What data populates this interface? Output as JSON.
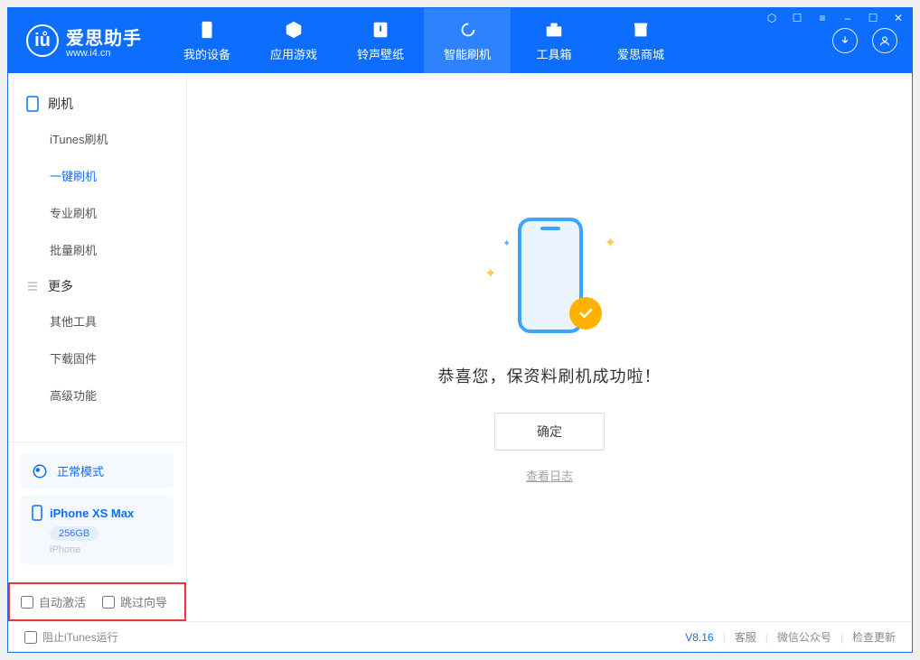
{
  "brand": {
    "name_cn": "爱思助手",
    "name_en": "www.i4.cn"
  },
  "tabs": [
    {
      "label": "我的设备"
    },
    {
      "label": "应用游戏"
    },
    {
      "label": "铃声壁纸"
    },
    {
      "label": "智能刷机"
    },
    {
      "label": "工具箱"
    },
    {
      "label": "爱思商城"
    }
  ],
  "sidebar": {
    "section_flash": "刷机",
    "items_flash": [
      {
        "label": "iTunes刷机"
      },
      {
        "label": "一键刷机"
      },
      {
        "label": "专业刷机"
      },
      {
        "label": "批量刷机"
      }
    ],
    "section_more": "更多",
    "items_more": [
      {
        "label": "其他工具"
      },
      {
        "label": "下载固件"
      },
      {
        "label": "高级功能"
      }
    ],
    "mode": "正常模式",
    "device_name": "iPhone XS Max",
    "device_capacity": "256GB",
    "device_type": "iPhone",
    "opt_auto_activate": "自动激活",
    "opt_skip_guide": "跳过向导"
  },
  "result": {
    "message": "恭喜您，保资料刷机成功啦！",
    "ok": "确定",
    "log": "查看日志"
  },
  "footer": {
    "block_itunes": "阻止iTunes运行",
    "version": "V8.16",
    "support": "客服",
    "wechat": "微信公众号",
    "update": "检查更新"
  }
}
